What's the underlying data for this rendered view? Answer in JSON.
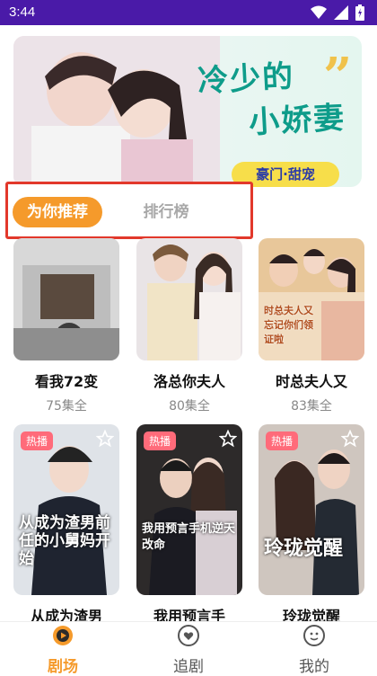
{
  "status": {
    "time": "3:44"
  },
  "banner": {
    "title_line1": "冷少的",
    "title_line2": "小娇妻",
    "tag": "豪门·甜宠"
  },
  "tabs": {
    "active": "为你推荐",
    "other": "排行榜"
  },
  "cards": [
    {
      "name": "看我72变",
      "eps": "75集全",
      "badge": "",
      "poster_text": ""
    },
    {
      "name": "洛总你夫人",
      "eps": "80集全",
      "badge": "",
      "poster_text": ""
    },
    {
      "name": "时总夫人又",
      "eps": "83集全",
      "badge": "",
      "poster_text": "时总夫人又忘记你们领证啦"
    },
    {
      "name": "从成为渣男",
      "eps": "",
      "badge": "热播",
      "poster_text": "从成为渣男前任的小舅妈开始"
    },
    {
      "name": "我用预言手",
      "eps": "",
      "badge": "热播",
      "poster_text": "我用预言手机逆天改命"
    },
    {
      "name": "玲珑觉醒",
      "eps": "",
      "badge": "热播",
      "poster_text": "玲珑觉醒"
    }
  ],
  "nav": {
    "items": [
      "剧场",
      "追剧",
      "我的"
    ]
  },
  "colors": {
    "accent": "#f59a2b",
    "statusbar": "#4a1aa8",
    "highlight": "#e2382b",
    "badge": "#ff6b7a"
  }
}
